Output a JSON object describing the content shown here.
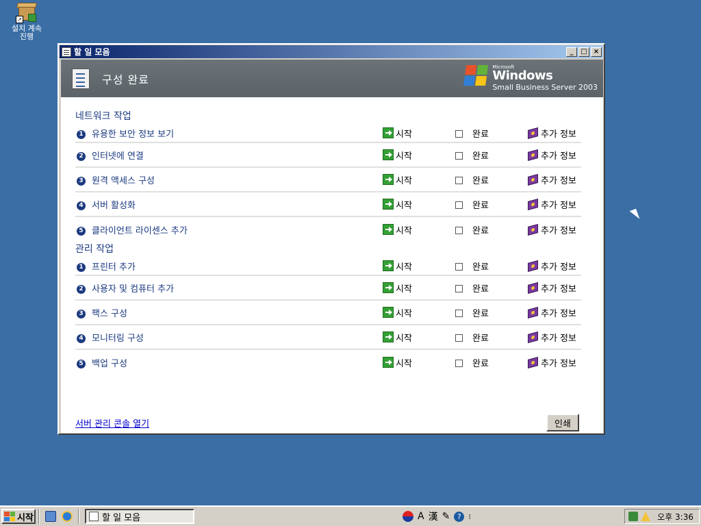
{
  "desktop": {
    "icon_label_line1": "설치 계속",
    "icon_label_line2": "진행"
  },
  "window": {
    "title": "할 일 모음",
    "controls": {
      "minimize": "_",
      "maximize": "□",
      "close": "×"
    }
  },
  "banner": {
    "title": "구성 완료",
    "brand_microsoft": "Microsoft",
    "brand_windows": "Windows",
    "brand_sbs": "Small Business Server 2003"
  },
  "labels": {
    "start": "시작",
    "done": "완료",
    "info": "추가 정보"
  },
  "sections": [
    {
      "title": "네트워크 작업",
      "tasks": [
        {
          "num": "1",
          "label": "유용한 보안 정보 보기"
        },
        {
          "num": "2",
          "label": "인터넷에 연결"
        },
        {
          "num": "3",
          "label": "원격 액세스 구성"
        },
        {
          "num": "4",
          "label": "서버 활성화"
        },
        {
          "num": "5",
          "label": "클라이언트 라이센스 추가"
        }
      ]
    },
    {
      "title": "관리 작업",
      "tasks": [
        {
          "num": "1",
          "label": "프린터 추가"
        },
        {
          "num": "2",
          "label": "사용자 및 컴퓨터 추가"
        },
        {
          "num": "3",
          "label": "팩스 구성"
        },
        {
          "num": "4",
          "label": "모니터링 구성"
        },
        {
          "num": "5",
          "label": "백업 구성"
        }
      ]
    }
  ],
  "footer": {
    "link": "서버 관리 콘솔 열기",
    "print": "인쇄"
  },
  "taskbar": {
    "start": "시작",
    "task_button": "할 일 모음",
    "ime_mode": "A",
    "ime_hanja": "漢",
    "ime_help": "?",
    "clock": "오후 3:36"
  },
  "colors": {
    "desktop": "#3a6ea5",
    "banner": "#5b6368",
    "task_text": "#1b3a80",
    "link": "#0000cc"
  }
}
